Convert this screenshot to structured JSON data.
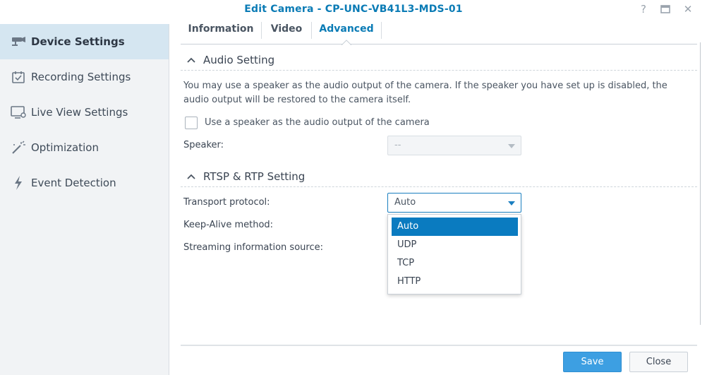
{
  "window": {
    "title": "Edit Camera - CP-UNC-VB41L3-MDS-01",
    "help_glyph": "?",
    "maximize_glyph": "□",
    "close_glyph": "✕"
  },
  "sidebar": {
    "items": [
      {
        "label": "Device Settings",
        "icon": "camera-icon",
        "active": true
      },
      {
        "label": "Recording Settings",
        "icon": "calendar-check-icon",
        "active": false
      },
      {
        "label": "Live View Settings",
        "icon": "monitor-icon",
        "active": false
      },
      {
        "label": "Optimization",
        "icon": "magic-wand-icon",
        "active": false
      },
      {
        "label": "Event Detection",
        "icon": "lightning-icon",
        "active": false
      }
    ]
  },
  "tabs": [
    {
      "label": "Information",
      "active": false
    },
    {
      "label": "Video",
      "active": false
    },
    {
      "label": "Advanced",
      "active": true
    }
  ],
  "audio": {
    "section_title": "Audio Setting",
    "description": "You may use a speaker as the audio output of the camera. If the speaker you have set up is disabled, the audio output will be restored to the camera itself.",
    "checkbox_label": "Use a speaker as the audio output of the camera",
    "checkbox_checked": false,
    "speaker_label": "Speaker:",
    "speaker_value": "--"
  },
  "rtsp": {
    "section_title": "RTSP & RTP Setting",
    "transport_label": "Transport protocol:",
    "transport_value": "Auto",
    "keepalive_label": "Keep-Alive method:",
    "streaming_label": "Streaming information source:",
    "options": [
      "Auto",
      "UDP",
      "TCP",
      "HTTP"
    ],
    "selected_option": "Auto"
  },
  "footer": {
    "save_label": "Save",
    "close_label": "Close"
  },
  "colors": {
    "accent": "#0a7bb5",
    "selected_option_bg": "#0a7bc0",
    "save_button": "#3d9fe2",
    "sidebar_active": "#d5e6f1"
  }
}
